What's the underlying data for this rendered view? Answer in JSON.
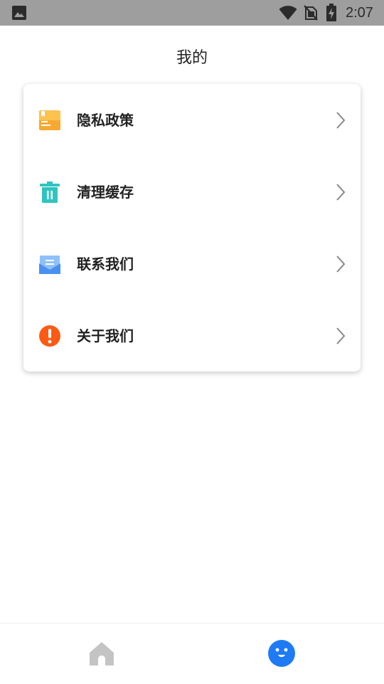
{
  "status_bar": {
    "time": "2:07",
    "icons": [
      "gallery-icon",
      "wifi-icon",
      "no-sim-icon",
      "battery-charging-icon"
    ]
  },
  "header": {
    "title": "我的"
  },
  "menu": {
    "items": [
      {
        "label": "隐私政策",
        "icon": "privacy-policy-icon",
        "icon_color": "#F7A932"
      },
      {
        "label": "清理缓存",
        "icon": "trash-icon",
        "icon_color": "#2EC4C0"
      },
      {
        "label": "联系我们",
        "icon": "mail-icon",
        "icon_color": "#4A90F0"
      },
      {
        "label": "关于我们",
        "icon": "exclamation-icon",
        "icon_color": "#FF5A14"
      }
    ]
  },
  "bottom_nav": {
    "items": [
      {
        "name": "home",
        "icon": "home-icon",
        "active": false,
        "color": "#C4C4C4"
      },
      {
        "name": "mine",
        "icon": "smiley-face-icon",
        "active": true,
        "color": "#1F7BF5"
      }
    ]
  },
  "colors": {
    "status_bar_bg": "#9E9E9E",
    "card_bg": "#FFFFFF",
    "text_primary": "#222222",
    "chevron": "#888888"
  }
}
